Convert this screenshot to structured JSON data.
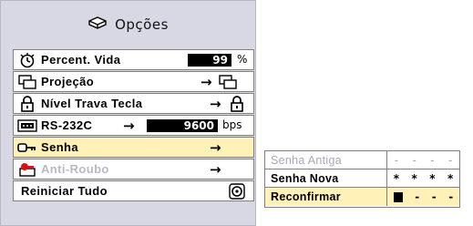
{
  "menu": {
    "title": "Opções",
    "items": [
      {
        "label": "Percent. Vida",
        "value": "99",
        "unit": "%"
      },
      {
        "label": "Projeção",
        "arrow": "→"
      },
      {
        "label": "Nível Trava Tecla",
        "arrow": "→"
      },
      {
        "label": "RS-232C",
        "arrow": "→",
        "value": "9600",
        "unit": "bps"
      },
      {
        "label": "Senha",
        "arrow": "→"
      },
      {
        "label": "Anti-Roubo",
        "arrow": "→"
      },
      {
        "label": "Reiniciar Tudo"
      }
    ]
  },
  "password": {
    "rows": [
      {
        "label": "Senha Antiga",
        "chars": [
          "-",
          "-",
          "-",
          "-"
        ]
      },
      {
        "label": "Senha Nova",
        "chars": [
          "*",
          "*",
          "*",
          "*"
        ]
      },
      {
        "label": "Reconfirmar",
        "chars": [
          "-",
          "-",
          "-"
        ]
      }
    ]
  },
  "colors": {
    "panel": "#d8d8e4",
    "selected": "#fff1b8",
    "disabled_text": "#b8b8c8"
  }
}
